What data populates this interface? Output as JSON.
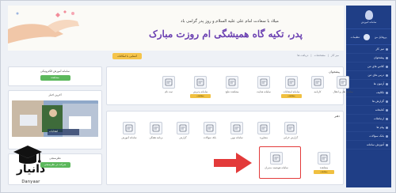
{
  "sidebar": {
    "org_name": "سامانه آموزش",
    "user_items": [
      "پروفایل من",
      "تنظیمات"
    ],
    "items": [
      {
        "label": "میز کار",
        "icon": "home-icon"
      },
      {
        "label": "پیشخوان",
        "icon": "dashboard-icon"
      },
      {
        "label": "کلاس های من",
        "icon": "class-icon"
      },
      {
        "label": "درس های من",
        "icon": "book-icon"
      },
      {
        "label": "آزمون ها",
        "icon": "exam-icon"
      },
      {
        "label": "تکالیف",
        "icon": "task-icon"
      },
      {
        "label": "گزارش ها",
        "icon": "report-icon"
      },
      {
        "label": "کتابخانه",
        "icon": "library-icon"
      },
      {
        "label": "ارتباطات",
        "icon": "chat-icon"
      },
      {
        "label": "پیام ها",
        "icon": "mail-icon"
      },
      {
        "label": "بانک سوالات",
        "icon": "question-icon"
      },
      {
        "label": "آموزش سامانه",
        "icon": "help-icon"
      }
    ]
  },
  "banner": {
    "small_text": "میلاد با سعادت امام علی علیه السلام و روز پدر گرامی باد",
    "big_text": "پدر، تکیه گاه همیشگی ام روزت مبارک"
  },
  "topbar": {
    "help_button": "آشنایی با امکانات",
    "breadcrumb": [
      "میز کار",
      "مشخصات",
      "دریافت ها"
    ]
  },
  "left_col": {
    "card1_title": "سامانه آموزش الکترونیکی",
    "card1_button": "مشاهده",
    "news_title": "آخرین اخبار",
    "news_caption": "انتخابات",
    "card3_title": "نظرسنجی",
    "card3_button": "شرکت در نظرسنجی"
  },
  "panel_top": {
    "title": "پیشخوان",
    "tiles": [
      {
        "label": "ثبت نام",
        "badge": "",
        "icon": "plus-icon"
      },
      {
        "label": "سامانه پذیرش",
        "badge": "مشاهده",
        "icon": "form-icon"
      },
      {
        "label": "مشاهده نتایج",
        "badge": "",
        "icon": "user-search-icon"
      },
      {
        "label": "سامانه هدایت",
        "badge": "",
        "icon": "document-icon"
      },
      {
        "label": "سامانه امتحانات",
        "badge": "مشاهده",
        "icon": "exam-icon"
      },
      {
        "label": "کارنامه",
        "badge": "",
        "icon": "card-icon"
      },
      {
        "label": "سامانه نقل و انتقال",
        "badge": "",
        "icon": "transfer-icon"
      }
    ]
  },
  "panel_bottom": {
    "title": "دفتر",
    "tiles": [
      {
        "label": "سامانه آموزش",
        "badge": "",
        "icon": "monitor-icon"
      },
      {
        "label": "برنامه هفتگی",
        "badge": "",
        "icon": "calendar-icon"
      },
      {
        "label": "گزارش",
        "badge": "",
        "icon": "chart-icon"
      },
      {
        "label": "بانک سوالات",
        "badge": "",
        "icon": "bank-icon"
      },
      {
        "label": "سامانه نوین",
        "badge": "",
        "icon": "layers-icon"
      },
      {
        "label": "مشاوره",
        "badge": "",
        "icon": "people-icon"
      },
      {
        "label": "گزارش خرابی",
        "badge": "",
        "icon": "alert-icon"
      },
      {
        "label": "سامانه هوشمند مدیران",
        "badge": "",
        "icon": "pc-icon"
      },
      {
        "label": "مشاهده",
        "badge": "مشاهده",
        "icon": "cube-icon"
      }
    ]
  },
  "watermark": {
    "brand_fa": "دانیار",
    "brand_en": "Danyaar"
  },
  "colors": {
    "sidebar": "#1f3e86",
    "accent_yellow": "#f5c44b",
    "green": "#5cb85c",
    "highlight_red": "#e33a3a"
  }
}
